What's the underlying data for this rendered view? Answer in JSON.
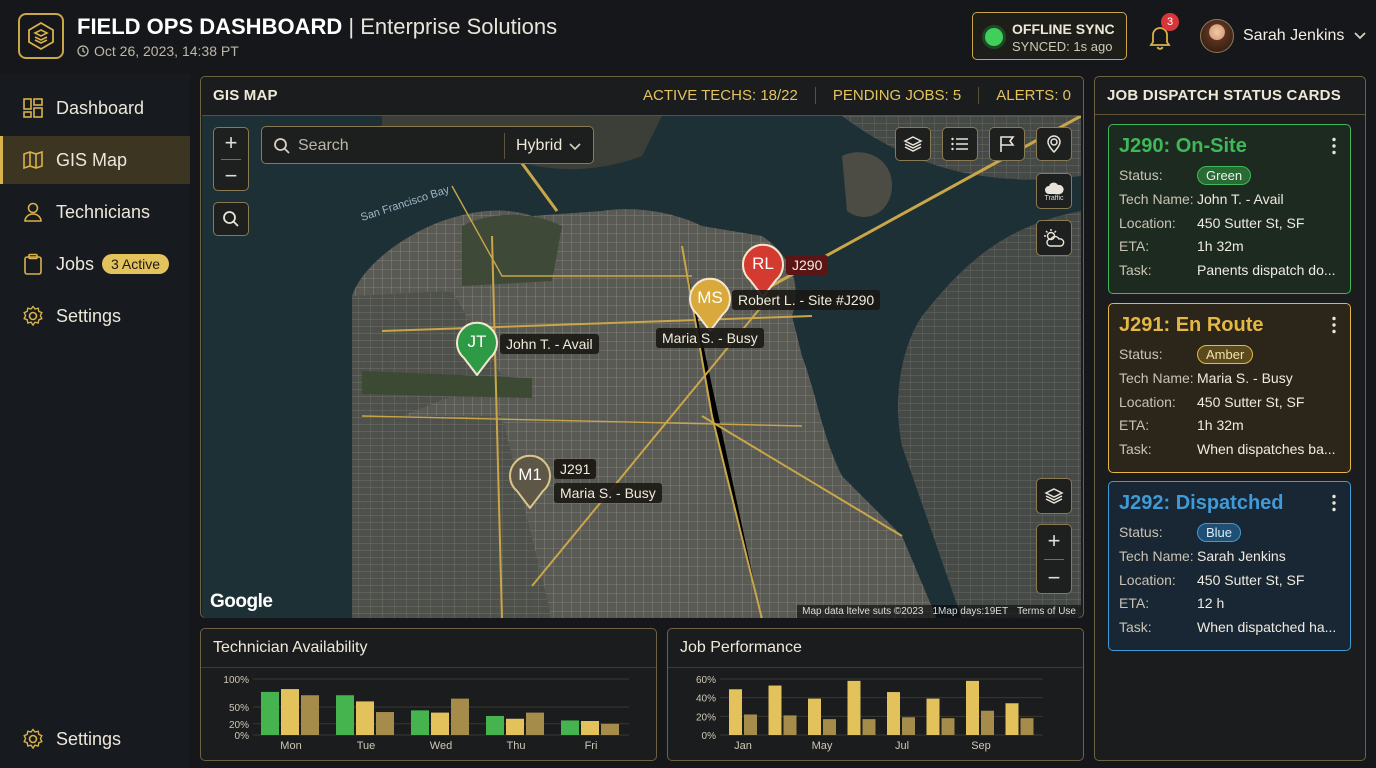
{
  "header": {
    "title": "FIELD OPS DASHBOARD",
    "separator": "|",
    "subtitle": "Enterprise Solutions",
    "datetime": "Oct 26, 2023, 14:38 PT",
    "sync_title": "OFFLINE SYNC",
    "sync_status": "SYNCED: 1s ago",
    "notification_count": "3",
    "user_name": "Sarah Jenkins"
  },
  "sidebar": {
    "items": [
      {
        "label": "Dashboard",
        "icon": "dashboard-icon"
      },
      {
        "label": "GIS Map",
        "icon": "map-icon",
        "active": true
      },
      {
        "label": "Technicians",
        "icon": "user-icon"
      },
      {
        "label": "Jobs",
        "icon": "clipboard-icon",
        "badge": "3 Active"
      },
      {
        "label": "Settings",
        "icon": "gear-icon"
      }
    ],
    "bottom_item": {
      "label": "Settings",
      "icon": "gear-icon"
    }
  },
  "map_panel": {
    "title": "GIS MAP",
    "stats": [
      {
        "label": "ACTIVE TECHS:",
        "value": "18/22"
      },
      {
        "label": "PENDING JOBS:",
        "value": "5"
      },
      {
        "label": "ALERTS:",
        "value": "0"
      }
    ],
    "search_placeholder": "Search",
    "map_mode": "Hybrid",
    "bay_label": "San Francisco Bay",
    "traffic_label": "Traffic",
    "google_logo": "Google",
    "attribution": [
      "Map data ltelve suts ©2023",
      "1Map days:19ET",
      "Terms of Use"
    ],
    "pins": [
      {
        "initials": "RL",
        "job": "J290",
        "label": "Robert L. - Site #J290",
        "color": "#d43a2f"
      },
      {
        "initials": "MS",
        "job": "",
        "label": "Maria S. - Busy",
        "color": "#d9a93b"
      },
      {
        "initials": "JT",
        "job": "",
        "label": "John T. - Avail",
        "color": "#2e9a45"
      },
      {
        "initials": "M1",
        "job": "J291",
        "label": "Maria S. - Busy",
        "color": "#8a7d62"
      }
    ]
  },
  "chart_data": [
    {
      "type": "bar",
      "title": "Technician Availability",
      "categories": [
        "Mon",
        "Tue",
        "Wed",
        "Thu",
        "Fri"
      ],
      "ylim": [
        0,
        100
      ],
      "yticks": [
        "100%",
        "50%",
        "20%",
        "0%"
      ],
      "series": [
        {
          "values": [
            77,
            71,
            44,
            34,
            26
          ],
          "color": "#45b34e"
        },
        {
          "values": [
            82,
            60,
            40,
            29,
            25
          ],
          "color": "#e3c25c"
        },
        {
          "values": [
            71,
            41,
            65,
            40,
            20
          ],
          "color": "#a58c4a"
        }
      ]
    },
    {
      "type": "bar",
      "title": "Job Performance",
      "categories": [
        "Jan",
        "May",
        "Jul",
        "Sep"
      ],
      "ylim": [
        0,
        60
      ],
      "yticks": [
        "60%",
        "40%",
        "20%",
        "0%"
      ],
      "series": [
        {
          "values": [
            49,
            53,
            39,
            58,
            46,
            39,
            58,
            34
          ],
          "color": "#e3c25c"
        },
        {
          "values": [
            22,
            21,
            17,
            17,
            19,
            18,
            26,
            18
          ],
          "color": "#a58c4a"
        }
      ]
    }
  ],
  "dispatch_panel": {
    "title": "JOB DISPATCH STATUS CARDS",
    "field_labels": {
      "status": "Status:",
      "tech": "Tech Name:",
      "location": "Location:",
      "eta": "ETA:",
      "task": "Task:"
    },
    "cards": [
      {
        "title": "J290: On-Site",
        "status": "Green",
        "tech": "John T. - Avail",
        "location": "450 Sutter St, SF",
        "eta": "1h 32m",
        "task": "Panents dispatch do...",
        "accent": "#3fb85a",
        "bg": "#1c2a1f",
        "badge_bg": "#2a6a35",
        "badge_fg": "#e9f3e8"
      },
      {
        "title": "J291: En Route",
        "status": "Amber",
        "tech": "Maria S. - Busy",
        "location": "450 Sutter St, SF",
        "eta": "1h 32m",
        "task": "When dispatches ba...",
        "accent": "#e5b744",
        "bg": "#2b2619",
        "badge_bg": "#5a4a1e",
        "badge_fg": "#f3e2a8"
      },
      {
        "title": "J292: Dispatched",
        "status": "Blue",
        "tech": "Sarah Jenkins",
        "location": "450 Sutter St, SF",
        "eta": "12 h",
        "task": "When dispatched ha...",
        "accent": "#3f9ad8",
        "bg": "#192633",
        "badge_bg": "#1f4f73",
        "badge_fg": "#dcecf8"
      }
    ]
  }
}
